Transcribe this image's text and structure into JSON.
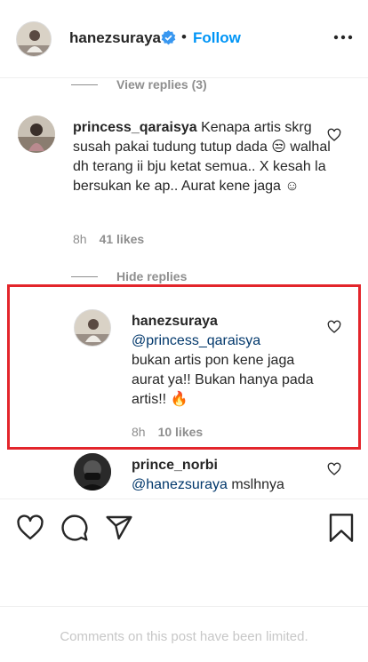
{
  "header": {
    "username": "hanezsuraya",
    "separator": "•",
    "follow_label": "Follow"
  },
  "view_replies_label": "View replies (3)",
  "comment1": {
    "username": "princess_qaraisya",
    "text": "Kenapa artis skrg susah pakai tudung tutup dada 😒 walhal dh terang ii bju ketat semua.. X kesah la bersukan ke ap.. Aurat kene jaga ☺",
    "time": "8h",
    "likes": "41 likes"
  },
  "hide_replies_label": "Hide replies",
  "reply1": {
    "username": "hanezsuraya",
    "mention": "@princess_qaraisya",
    "text": "bukan artis pon kene jaga aurat ya!! Bukan hanya pada artis!! 🔥",
    "time": "8h",
    "likes": "10 likes"
  },
  "reply2": {
    "username": "prince_norbi",
    "mention": "@hanezsuraya",
    "text": "mslhnya"
  },
  "footer": {
    "limited_text": "Comments on this post have been limited."
  },
  "colors": {
    "link_blue": "#0095f6",
    "mention_blue": "#00376b",
    "highlight_red": "#e3252b",
    "muted_gray": "#8e8e8e"
  }
}
